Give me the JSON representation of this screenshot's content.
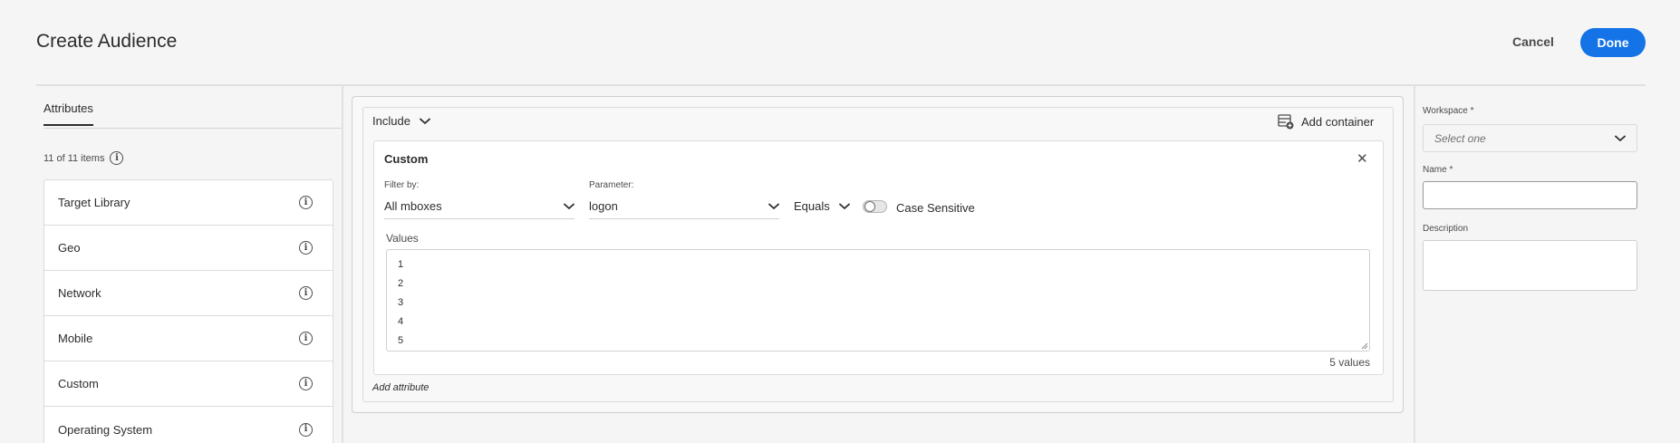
{
  "header": {
    "title": "Create Audience",
    "cancel_label": "Cancel",
    "done_label": "Done",
    "accent_color": "#1473e6"
  },
  "left_pane": {
    "tab_label": "Attributes",
    "items_count": "11 of 11 items",
    "items": [
      {
        "label": "Target Library",
        "icon": "info-icon"
      },
      {
        "label": "Geo",
        "icon": "info-icon"
      },
      {
        "label": "Network",
        "icon": "info-icon"
      },
      {
        "label": "Mobile",
        "icon": "info-icon"
      },
      {
        "label": "Custom",
        "icon": "info-icon"
      },
      {
        "label": "Operating System",
        "icon": "info-icon"
      }
    ]
  },
  "builder": {
    "include_label": "Include",
    "add_container_label": "Add container",
    "rule": {
      "title": "Custom",
      "filter_by_label": "Filter by:",
      "filter_by_value": "All mboxes",
      "parameter_label": "Parameter:",
      "parameter_value": "logon",
      "operator_value": "Equals",
      "case_sensitive_label": "Case Sensitive",
      "values_label": "Values",
      "values": [
        "1",
        "2",
        "3",
        "4",
        "5"
      ],
      "values_count": "5 values"
    },
    "add_attribute_label": "Add attribute"
  },
  "right_panel": {
    "workspace_label": "Workspace *",
    "workspace_placeholder": "Select one",
    "name_label": "Name *",
    "name_value": "",
    "description_label": "Description",
    "description_value": ""
  }
}
